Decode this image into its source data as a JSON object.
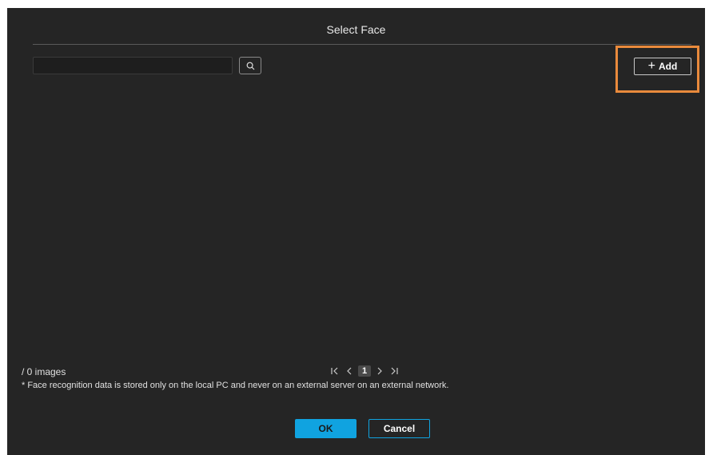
{
  "dialog": {
    "title": "Select Face"
  },
  "search": {
    "value": "",
    "placeholder": "",
    "button_icon": "search-icon"
  },
  "toolbar": {
    "add_label": "Add",
    "add_icon": "plus-icon",
    "highlight_color": "#e98a3c"
  },
  "footer": {
    "images_count": "/ 0 images",
    "notice": "* Face recognition data is stored only on the local PC and never on an external server on an external network."
  },
  "pagination": {
    "first_icon": "first-page-icon",
    "prev_icon": "prev-page-icon",
    "current_page": "1",
    "next_icon": "next-page-icon",
    "last_icon": "last-page-icon"
  },
  "actions": {
    "ok_label": "OK",
    "cancel_label": "Cancel",
    "accent_color": "#10a3e0"
  }
}
